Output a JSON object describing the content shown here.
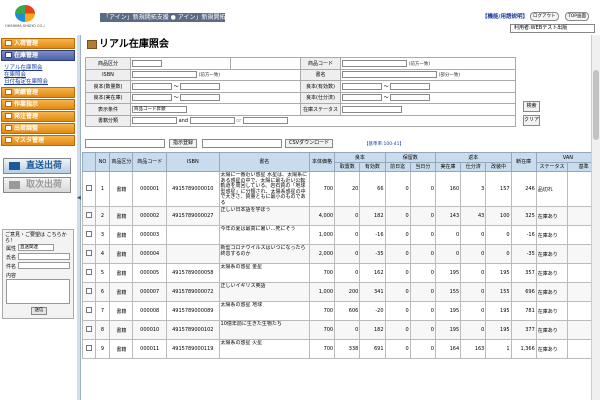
{
  "header": {
    "logo_text": "OHSHIMA SHIGYO CO.,LTD.",
    "tagline": "「アイン」新規開拓支援 ● アイン」新規開拓",
    "help_link": "【機能/用語説明】",
    "logout_label": "ログアウト",
    "top_label": "TOP画面",
    "company_label": "利用者:WEBテスト出版"
  },
  "sidebar": {
    "menus": [
      {
        "label": "入荷管理"
      },
      {
        "label": "在庫管理"
      },
      {
        "label": "実績管理"
      },
      {
        "label": "作業指示"
      },
      {
        "label": "発注管理"
      },
      {
        "label": "出荷調整"
      },
      {
        "label": "マスタ管理"
      }
    ],
    "sublinks": [
      "リアル在庫照会",
      "在庫照会",
      "日付指定在庫照会"
    ],
    "big_buttons": [
      {
        "label": "直送出荷"
      },
      {
        "label": "取次出荷"
      }
    ],
    "inquiry": {
      "note": "ご意見・ご要望は こちらから！",
      "attr_label": "属性",
      "attr_value": "直送関連",
      "name_label": "氏名",
      "subject_label": "件名",
      "body_label": "内容",
      "send_label": "送信"
    }
  },
  "main": {
    "title": "リアル在庫照会",
    "search": {
      "category_label": "商品区分",
      "code_label": "商品コード",
      "code_note": "(前方一致)",
      "isbn_label": "ISBN",
      "isbn_note": "(前方一致)",
      "name_label": "書名",
      "name_note": "(部分一致)",
      "stock_label": "良本(数量数)",
      "valid_label": "良本(有効数)",
      "real_label": "良本(実在庫)",
      "alloc_label": "良本(仕分済)",
      "order_label": "表示条件",
      "order_value": "商品コード昇順",
      "status_label": "在庫ステータス",
      "sub_label": "書籍分類",
      "and_label": "and",
      "or_label": "or",
      "tilde": "〜",
      "search_button": "検索",
      "clear_button": "クリア"
    },
    "toolbar": {
      "instruct_button": "指示登録",
      "csv_button": "CSVダウンロード",
      "count_text": "【基準率:100-41】"
    },
    "columns": {
      "no": "NO",
      "cat": "商品区分",
      "code": "商品コード",
      "isbn": "ISBN",
      "name": "書名",
      "price": "本体価格",
      "good": "良本",
      "good_sub": [
        "取置数",
        "有効数"
      ],
      "hold": "保留数",
      "hold_sub": [
        "前日迄",
        "当日分"
      ],
      "ret": "返本",
      "ret_sub": [
        "実在庫",
        "仕分済",
        "改装中"
      ],
      "broken": "断在庫",
      "van": "VAN",
      "van_sub": [
        "ステータス",
        "基準"
      ]
    },
    "rows": [
      {
        "no": "1",
        "cat": "書籍",
        "code": "000001",
        "isbn": "4915789000010",
        "name": "太陽に一番近い惑星 水星は、太陽系にある惑星の中で、太陽に最も近い公転軌道を周回している。岩石質の「地球型惑星」に分類され、太陽系惑星の中で大きさ、質量ともに最小のものである",
        "price": "700",
        "g1": "20",
        "g2": "66",
        "h1": "0",
        "h2": "0",
        "r1": "160",
        "r2": "3",
        "r3": "157",
        "broken": "246",
        "status": "品切れ"
      },
      {
        "no": "2",
        "cat": "書籍",
        "code": "000002",
        "isbn": "4915789000027",
        "name": "正しい日本語を学ぼう",
        "price": "4,000",
        "g1": "0",
        "g2": "182",
        "h1": "0",
        "h2": "0",
        "r1": "143",
        "r2": "43",
        "r3": "100",
        "broken": "325",
        "status": "在庫あり"
      },
      {
        "no": "3",
        "cat": "書籍",
        "code": "000003",
        "isbn": "",
        "name": "今年の夏は最高に暑い…死にそう",
        "price": "1,000",
        "g1": "0",
        "g2": "-16",
        "h1": "0",
        "h2": "0",
        "r1": "0",
        "r2": "0",
        "r3": "0",
        "broken": "-16",
        "status": "在庫あり"
      },
      {
        "no": "4",
        "cat": "書籍",
        "code": "000004",
        "isbn": "",
        "name": "新型コロナウイルスはいつになったら終息するのか",
        "price": "2,000",
        "g1": "0",
        "g2": "-35",
        "h1": "0",
        "h2": "0",
        "r1": "0",
        "r2": "0",
        "r3": "0",
        "broken": "-35",
        "status": "在庫あり"
      },
      {
        "no": "5",
        "cat": "書籍",
        "code": "000005",
        "isbn": "4915789000058",
        "name": "太陽系の惑星 金星",
        "price": "700",
        "g1": "0",
        "g2": "162",
        "h1": "0",
        "h2": "0",
        "r1": "195",
        "r2": "0",
        "r3": "195",
        "broken": "357",
        "status": "在庫あり"
      },
      {
        "no": "6",
        "cat": "書籍",
        "code": "000007",
        "isbn": "4915789000072",
        "name": "正しいイギリス英語",
        "price": "1,000",
        "g1": "200",
        "g2": "341",
        "h1": "0",
        "h2": "0",
        "r1": "155",
        "r2": "0",
        "r3": "155",
        "broken": "696",
        "status": "在庫あり"
      },
      {
        "no": "7",
        "cat": "書籍",
        "code": "000008",
        "isbn": "4915789000089",
        "name": "太陽系の惑星 地球",
        "price": "700",
        "g1": "606",
        "g2": "-20",
        "h1": "0",
        "h2": "0",
        "r1": "195",
        "r2": "0",
        "r3": "195",
        "broken": "781",
        "status": "在庫あり"
      },
      {
        "no": "8",
        "cat": "書籍",
        "code": "000010",
        "isbn": "4915789000102",
        "name": "10億年前に生きた生物たち",
        "price": "700",
        "g1": "0",
        "g2": "182",
        "h1": "0",
        "h2": "0",
        "r1": "195",
        "r2": "0",
        "r3": "195",
        "broken": "377",
        "status": "在庫あり"
      },
      {
        "no": "9",
        "cat": "書籍",
        "code": "000011",
        "isbn": "4915789000119",
        "name": "太陽系の惑星 火星",
        "price": "700",
        "g1": "338",
        "g2": "691",
        "h1": "0",
        "h2": "0",
        "r1": "164",
        "r2": "163",
        "r3": "1",
        "broken": "1,366",
        "status": "在庫あり"
      }
    ]
  },
  "colors": {
    "menu_orange": "#e08a12",
    "menu_selected": "#4f62a6",
    "header_grid": "#c9dced",
    "link_blue": "#1a3c9c"
  }
}
